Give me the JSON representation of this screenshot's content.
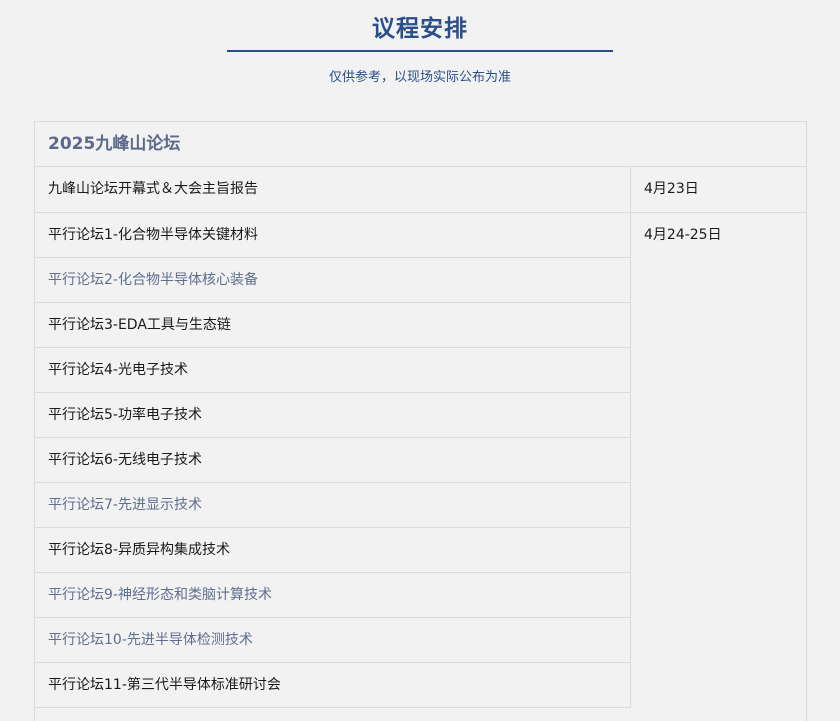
{
  "header": {
    "title": "议程安排",
    "subtitle": "仅供参考，以现场实际公布为准"
  },
  "schedule": {
    "title": "2025九峰山论坛",
    "rows": [
      {
        "name": "九峰山论坛开幕式＆大会主旨报告",
        "date": "4月23日",
        "muted": false
      },
      {
        "name": "平行论坛1-化合物半导体关键材料",
        "date": "4月24-25日",
        "muted": false
      },
      {
        "name": "平行论坛2-化合物半导体核心装备",
        "date": "",
        "muted": true
      },
      {
        "name": "平行论坛3-EDA工具与生态链",
        "date": "",
        "muted": false
      },
      {
        "name": "平行论坛4-光电子技术",
        "date": "",
        "muted": false
      },
      {
        "name": "平行论坛5-功率电子技术",
        "date": "",
        "muted": false
      },
      {
        "name": "平行论坛6-无线电子技术",
        "date": "",
        "muted": false
      },
      {
        "name": "平行论坛7-先进显示技术",
        "date": "",
        "muted": true
      },
      {
        "name": "平行论坛8-异质异构集成技术",
        "date": "",
        "muted": false
      },
      {
        "name": "平行论坛9-神经形态和类脑计算技术",
        "date": "",
        "muted": true
      },
      {
        "name": "平行论坛10-先进半导体检测技术",
        "date": "",
        "muted": true
      },
      {
        "name": "平行论坛11-第三代半导体标准研讨会",
        "date": "",
        "muted": false
      }
    ]
  }
}
